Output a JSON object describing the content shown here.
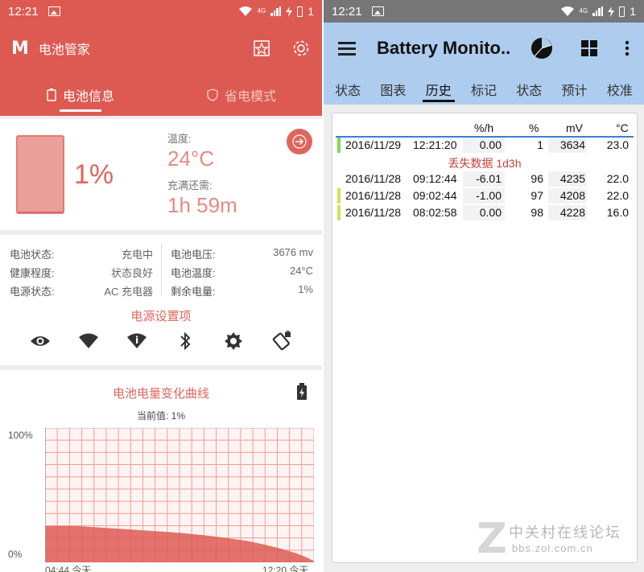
{
  "left": {
    "status_bar": {
      "time": "12:21",
      "network": "4G",
      "battery_level": "1"
    },
    "app_title": "电池管家",
    "tabs": [
      {
        "label": "电池信息",
        "active": true
      },
      {
        "label": "省电模式",
        "active": false
      }
    ],
    "summary": {
      "battery_fill_fraction": 0.01,
      "percent": "1%",
      "temp_label": "温度:",
      "temp_value": "24°C",
      "time_to_full_label": "充满还需:",
      "time_to_full_value": "1h 59m"
    },
    "info": {
      "left": [
        {
          "label": "电池状态:",
          "value": "充电中"
        },
        {
          "label": "健康程度:",
          "value": "状态良好"
        },
        {
          "label": "电源状态:",
          "value": "AC 充电器"
        }
      ],
      "right": [
        {
          "label": "电池电压:",
          "value": "3676 mv"
        },
        {
          "label": "电池温度:",
          "value": "24°C"
        },
        {
          "label": "剩余电量:",
          "value": "1%"
        }
      ]
    },
    "power_settings_title": "电源设置项",
    "power_setting_icons": [
      "eye-icon",
      "wifi-icon",
      "data-signal-icon",
      "bluetooth-icon",
      "brightness-icon",
      "rotation-lock-icon"
    ],
    "chart_data": {
      "type": "area",
      "title": "电池电量变化曲线",
      "current_value_label": "当前值: 1%",
      "ylabel_top": "100%",
      "ylabel_bottom": "0%",
      "xlabel_left": "04:44 今天",
      "xlabel_right": "12:20 今天",
      "ylim": [
        0,
        100
      ],
      "x": [
        0,
        0.12,
        0.2,
        0.35,
        0.5,
        0.6,
        0.68,
        0.75,
        0.82,
        0.88,
        0.93,
        0.97,
        1.0
      ],
      "values": [
        27,
        27,
        26,
        24,
        22,
        20,
        18,
        16,
        13,
        10,
        7,
        4,
        1
      ],
      "grid": true,
      "color": "#dd5a52"
    }
  },
  "right": {
    "status_bar": {
      "time": "12:21",
      "network": "4G",
      "battery_level": "1"
    },
    "app_title": "Battery Monito..",
    "tabs": [
      {
        "label": "状态",
        "active": false
      },
      {
        "label": "图表",
        "active": false
      },
      {
        "label": "历史",
        "active": true
      },
      {
        "label": "标记",
        "active": false
      },
      {
        "label": "状态",
        "active": false
      },
      {
        "label": "预计",
        "active": false
      },
      {
        "label": "校准",
        "active": false
      }
    ],
    "history": {
      "headers": {
        "rate": "%/h",
        "pct": "%",
        "mv": "mV",
        "temp": "°C"
      },
      "lost_data": "丢失数据 1d3h",
      "rows": [
        {
          "date": "2016/11/29",
          "time": "12:21:20",
          "rate": "0.00",
          "pct": "1",
          "mv": "3634",
          "temp": "23.0",
          "marker": "#7ed957"
        },
        {
          "date": "2016/11/28",
          "time": "09:12:44",
          "rate": "-6.01",
          "pct": "96",
          "mv": "4235",
          "temp": "22.0",
          "marker": ""
        },
        {
          "date": "2016/11/28",
          "time": "09:02:44",
          "rate": "-1.00",
          "pct": "97",
          "mv": "4208",
          "temp": "22.0",
          "marker": "#d7df5a"
        },
        {
          "date": "2016/11/28",
          "time": "08:02:58",
          "rate": "0.00",
          "pct": "98",
          "mv": "4228",
          "temp": "16.0",
          "marker": "#d7df5a"
        }
      ]
    },
    "watermark": {
      "cn": "中关村在线论坛",
      "url": "bbs.zol.com.cn"
    }
  }
}
